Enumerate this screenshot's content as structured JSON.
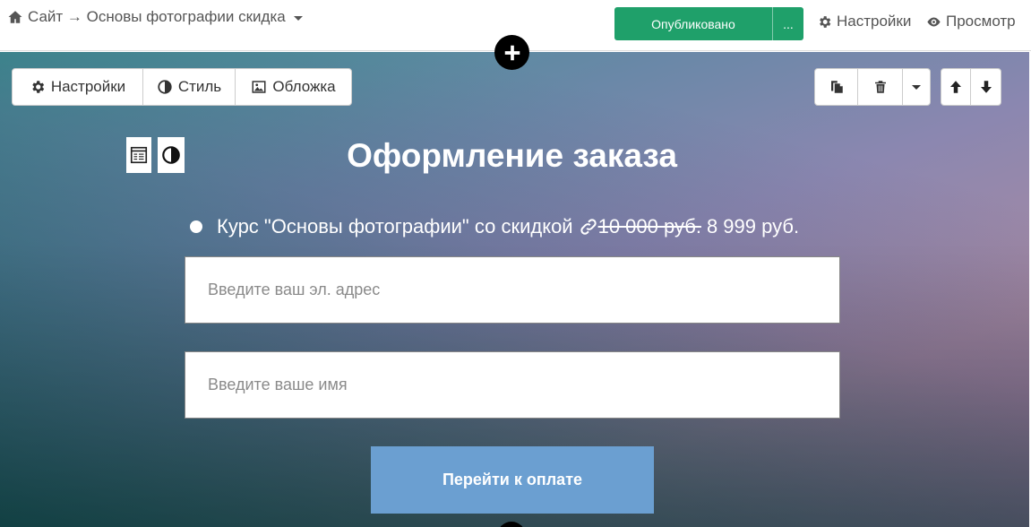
{
  "topbar": {
    "breadcrumb": "Сайт → Основы фотографии скидка",
    "publish_label": "Опубликовано",
    "publish_more_label": "...",
    "settings_label": "Настройки",
    "preview_label": "Просмотр",
    "publish_color": "#1fa06a"
  },
  "block_toolbar": {
    "settings_label": "Настройки",
    "style_label": "Стиль",
    "cover_label": "Обложка"
  },
  "content": {
    "title": "Оформление заказа",
    "offer_text": "Курс \"Основы фотографии\" со скидкой",
    "offer_old_price": "10 000 руб.",
    "offer_new_price": "8 999 руб.",
    "email_placeholder": "Введите ваш эл. адрес",
    "name_placeholder": "Введите ваше имя",
    "pay_button_label": "Перейти к оплате",
    "pay_button_color": "#6b9fd1"
  },
  "icons": [
    "home-icon",
    "gear-icon",
    "eye-icon",
    "plus-icon",
    "contrast-icon",
    "image-icon",
    "copy-icon",
    "trash-icon",
    "arrow-up-icon",
    "arrow-down-icon",
    "form-icon",
    "link-icon"
  ]
}
